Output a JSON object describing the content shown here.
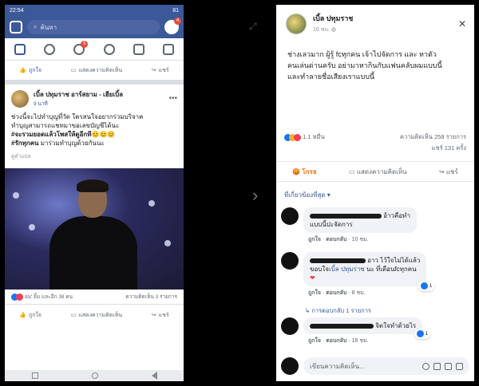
{
  "left": {
    "status_time": "22:54",
    "battery": "81",
    "search_placeholder": "ค้นหา",
    "messenger_badge": "4",
    "groups_badge": "5",
    "top_actions": {
      "like": "ถูกใจ",
      "comment": "แสดงความคิดเห็น",
      "share": "แชร์"
    },
    "post": {
      "author": "เบิ้ล ปทุมราช อาร์สยาม - เฮียเบิ้ล",
      "time": "9 นาที",
      "text_line1": "ช่วงนี้จะไปทำบุญที่วัด ใครสนใจอยากร่วมบริจาค",
      "text_line2": "ทำบุญสามารถแชทมาขอเลขบัญชีได้นะ",
      "hashtag1": "#จะรวมยอดแล้วโพสให้ดูอีกที",
      "emoji": "😊😊😊",
      "hashtag2": "#รักทุกคน",
      "text_end": "มาร่วมทำบุญด้วยกันนะ",
      "translate": "ดูคำแปล",
      "reactions": "อม' ยิ้ม และอีก 38 คน",
      "counts": "ความคิดเห็น 3 รายการ"
    },
    "bottom_actions": {
      "like": "ถูกใจ",
      "comment": "แสดงความคิดเห็น",
      "share": "แชร์"
    }
  },
  "right": {
    "author": "เบิ้ล ปทุมราช",
    "time": "16 ชม.",
    "text_line1": "ช่างเลวมาก ผู้รู้ fcทุกคน เจ้าไปจัดการ และ หาตัว",
    "text_line2": "คนเล่นด่านครับ อย่ามาหากินกับแฟนคลับผมแบบนี้",
    "text_line3": "และทำลายชื่อเสียงเราแบบนี้",
    "reaction_count": "1.1 หมื่น",
    "comment_count": "ความคิดเห็น 258 รายการ",
    "share_count": "แชร์ 131 ครั้ง",
    "actions": {
      "react": "โกรธ",
      "comment": "แสดงความคิดเห็น",
      "share": "แชร์"
    },
    "relevant": "ที่เกี่ยวข้องที่สุด ▾",
    "comments": [
      {
        "text": "อ้าวคือทำ",
        "text2": "แบบนี้ปะจัดการ",
        "meta_like": "ถูกใจ",
        "meta_reply": "ตอบกลับ",
        "meta_time": "10 ชม."
      },
      {
        "text": "อาว ไว้ใจไม่ได้แล้ว",
        "text2": "ขอบใจ",
        "mention": "เบิ้ล ปทุมราช",
        "text3": "นะ ที่เตือนfcทุกคน",
        "like_badge": "1",
        "meta_like": "ถูกใจ",
        "meta_reply": "ตอบกลับ",
        "meta_time": "8 ชม."
      },
      {
        "text": "จิตใจทำด้วยไร",
        "like_badge": "1",
        "meta_like": "ถูกใจ",
        "meta_reply": "ตอบกลับ",
        "meta_time": "16 ชม."
      }
    ],
    "replies_link": "↳ การตอบกลับ 1 รายการ",
    "input_placeholder": "เขียนความคิดเห็น..."
  }
}
